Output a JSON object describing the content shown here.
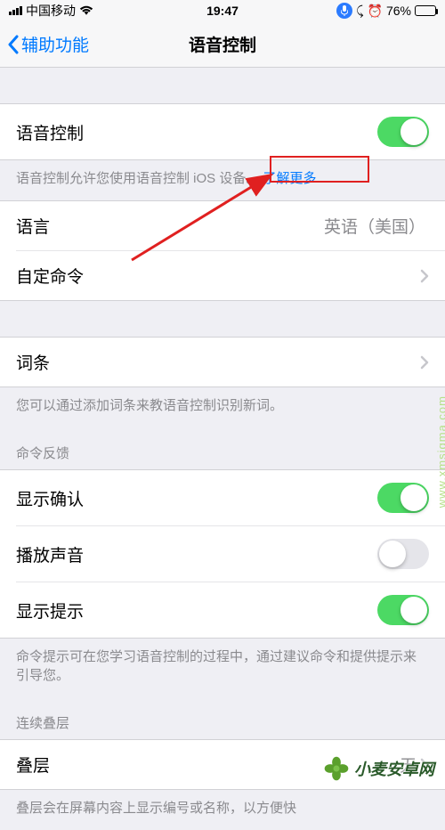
{
  "status": {
    "carrier": "中国移动",
    "time": "19:47",
    "battery_pct": "76%",
    "alarm_glyph": "⏰",
    "lock_glyph": "⤹"
  },
  "nav": {
    "back": "辅助功能",
    "title": "语音控制"
  },
  "voice_control": {
    "label": "语音控制",
    "on": true,
    "desc": "语音控制允许您使用语音控制 iOS 设备。",
    "learn_more": "了解更多..."
  },
  "language": {
    "label": "语言",
    "value": "英语（美国）"
  },
  "custom_cmd": {
    "label": "自定命令"
  },
  "vocab": {
    "label": "词条",
    "desc": "您可以通过添加词条来教语音控制识别新词。"
  },
  "feedback": {
    "header": "命令反馈",
    "show_confirm": {
      "label": "显示确认",
      "on": true
    },
    "play_sound": {
      "label": "播放声音",
      "on": false
    },
    "show_hints": {
      "label": "显示提示",
      "on": true
    },
    "desc": "命令提示可在您学习语音控制的过程中，通过建议命令和提供提示来引导您。"
  },
  "overlay": {
    "header": "连续叠层",
    "label": "叠层",
    "value": "无",
    "desc": "叠层会在屏幕内容上显示编号或名称，以方便快"
  },
  "watermark": {
    "text": "小麦安卓网",
    "url": "www.xmsigma.com"
  }
}
